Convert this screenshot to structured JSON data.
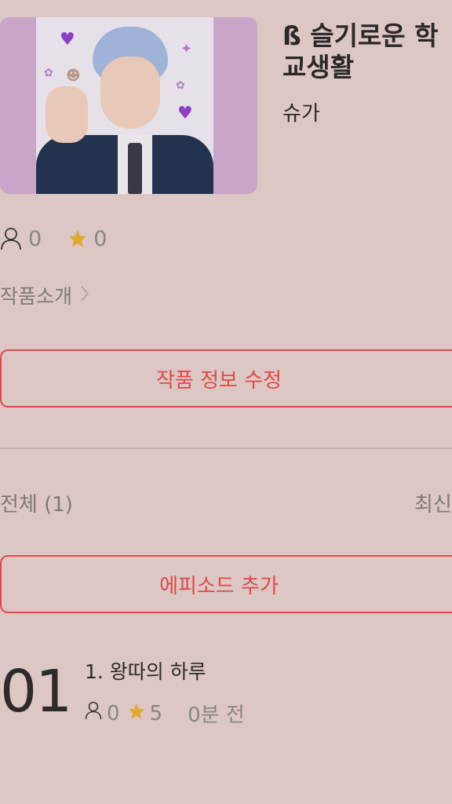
{
  "novel": {
    "title": "ß 슬기로운 학교생활",
    "author": "슈가",
    "views": "0",
    "likes": "0",
    "intro_label": "작품소개"
  },
  "actions": {
    "edit_label": "작품 정보 수정",
    "add_episode_label": "에피소드 추가"
  },
  "episode_list": {
    "count_label": "전체 (1)",
    "sort_label": "최신",
    "items": [
      {
        "number": "01",
        "title": "1. 왕따의 하루",
        "views": "0",
        "rating": "5",
        "time": "0분 전"
      }
    ]
  },
  "colors": {
    "background": "#dcc7c4",
    "accent": "#e04848",
    "star": "#e0a82e"
  },
  "icons": [
    "person-icon",
    "star-icon",
    "chevron-right-icon"
  ]
}
